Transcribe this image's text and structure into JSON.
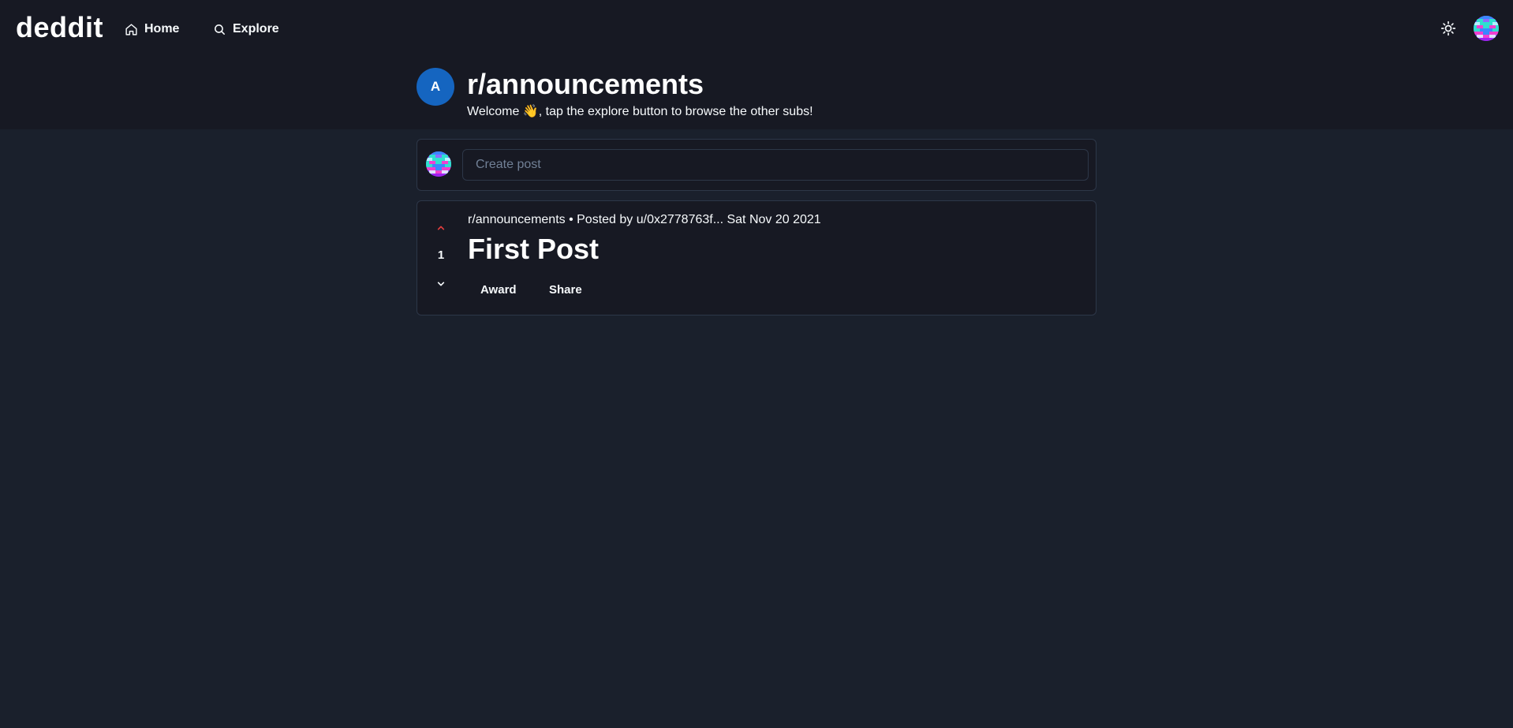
{
  "app": {
    "logo": "deddit"
  },
  "nav": {
    "home": {
      "label": "Home",
      "icon": "home-icon"
    },
    "explore": {
      "label": "Explore",
      "icon": "search-icon"
    }
  },
  "toolbar": {
    "theme_icon": "sun-icon",
    "avatar_icon": "pixel-avatar"
  },
  "subreddit": {
    "avatar_letter": "A",
    "avatar_color": "#1565c0",
    "name": "r/announcements",
    "description": "Welcome 👋, tap the explore button to browse the other subs!"
  },
  "create_post": {
    "placeholder": "Create post"
  },
  "posts": [
    {
      "meta": "r/announcements • Posted by u/0x2778763f... Sat Nov 20 2021",
      "title": "First Post",
      "votes": "1",
      "actions": {
        "award": "Award",
        "share": "Share"
      }
    }
  ],
  "colors": {
    "background": "#1a202c",
    "header": "#171923",
    "upvote": "#e53e3e",
    "border": "#2d3748"
  }
}
